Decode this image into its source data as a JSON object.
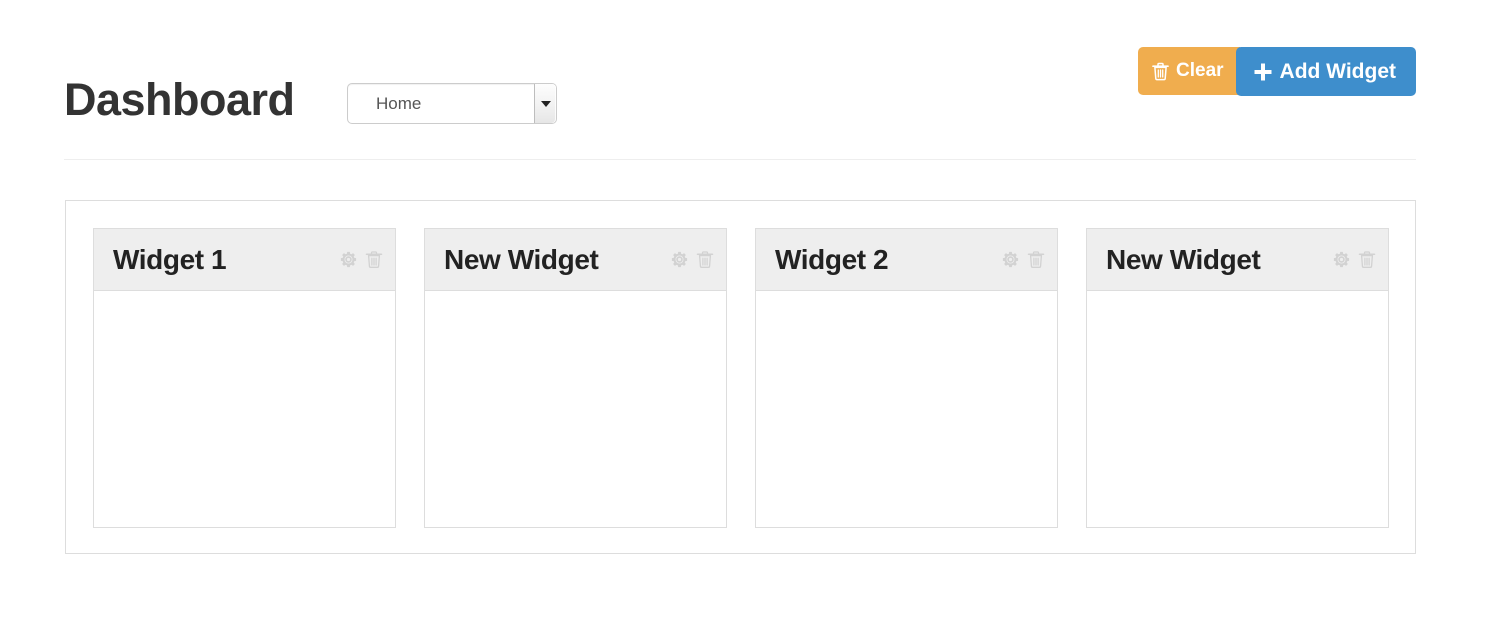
{
  "header": {
    "title": "Dashboard",
    "dashboard_select": {
      "name": "dashboard-select",
      "selected": "Home",
      "options": [
        "Home"
      ]
    }
  },
  "toolbar": {
    "clear_button": {
      "label": "Clear",
      "icon": "trash-icon",
      "color": "#f0ad4e"
    },
    "add_widget_button": {
      "label": "Add Widget",
      "icon": "plus-icon",
      "color": "#3e8ecc"
    }
  },
  "widgets": [
    {
      "title": "Widget 1",
      "settings_icon": "gear-icon",
      "delete_icon": "trash-icon",
      "body": ""
    },
    {
      "title": "New Widget",
      "settings_icon": "gear-icon",
      "delete_icon": "trash-icon",
      "body": ""
    },
    {
      "title": "Widget 2",
      "settings_icon": "gear-icon",
      "delete_icon": "trash-icon",
      "body": ""
    },
    {
      "title": "New Widget",
      "settings_icon": "gear-icon",
      "delete_icon": "trash-icon",
      "body": ""
    }
  ],
  "colors": {
    "page_background": "#ffffff",
    "title_text": "#333333",
    "widget_header_background": "#eeeeee",
    "border": "#dddddd",
    "icon_gray": "#d2d2d2",
    "warning": "#f0ad4e",
    "primary": "#3e8ecc"
  }
}
